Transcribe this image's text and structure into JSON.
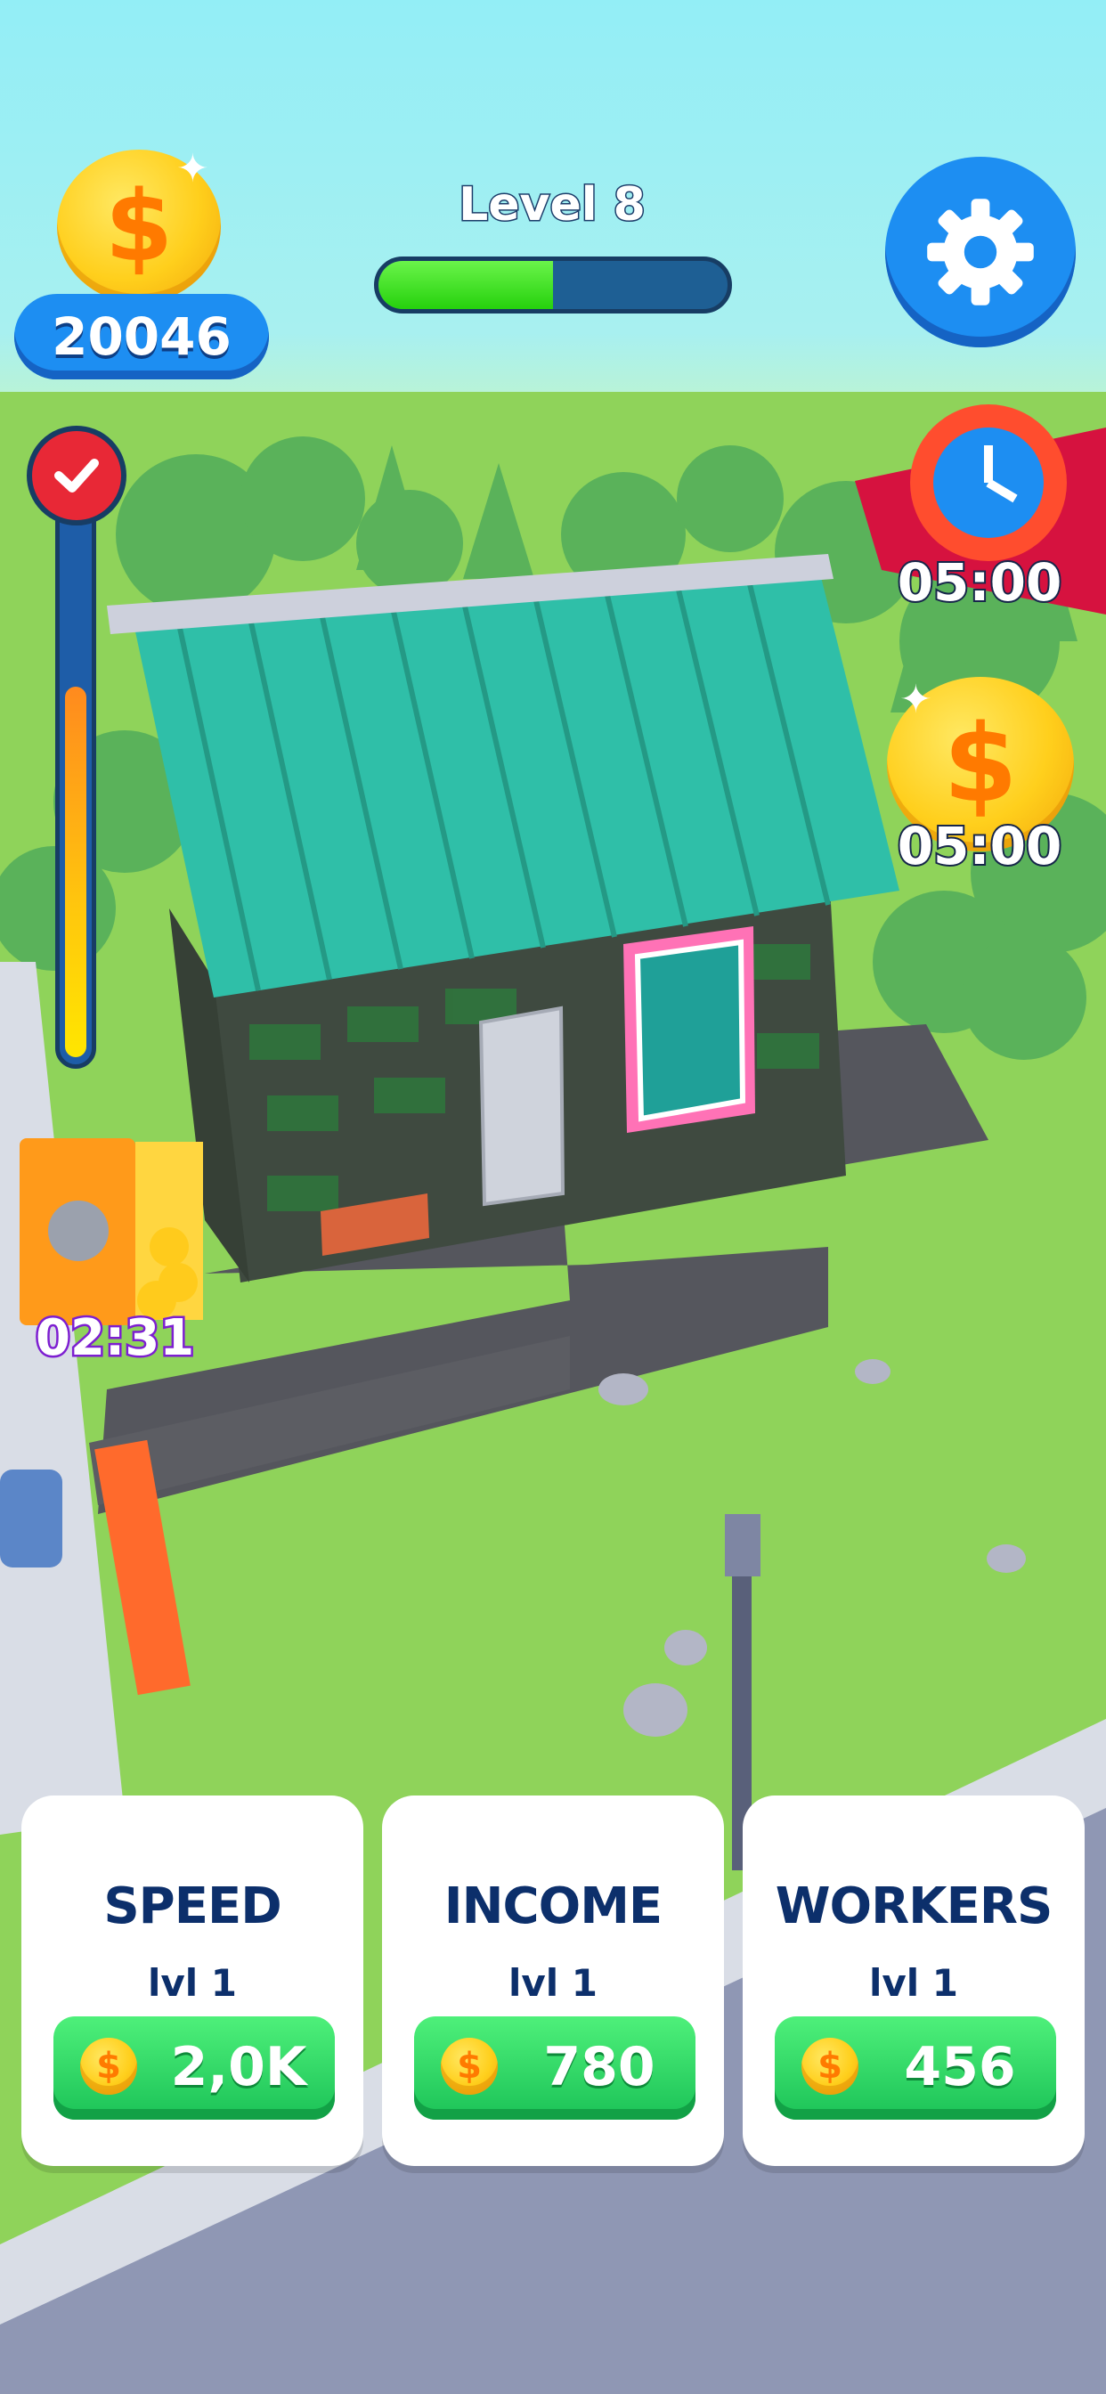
{
  "hud": {
    "coin_icon": "dollar-coin-icon",
    "coin_symbol": "$",
    "coins": "20046",
    "level_label": "Level 8",
    "level_progress": 0.5,
    "settings_icon": "gear-icon"
  },
  "progress_meter": {
    "fill_fraction": 0.66,
    "check_icon": "checkmark-icon"
  },
  "boosts": [
    {
      "icon": "speed-clock-icon",
      "timer": "05:00"
    },
    {
      "icon": "dollar-coin-icon",
      "symbol": "$",
      "timer": "05:00"
    }
  ],
  "safe": {
    "icon": "money-safe-icon",
    "timer": "02:31"
  },
  "upgrades": [
    {
      "title": "SPEED",
      "level": "lvl 1",
      "price": "2,0K",
      "coin_symbol": "$"
    },
    {
      "title": "INCOME",
      "level": "lvl 1",
      "price": "780",
      "coin_symbol": "$"
    },
    {
      "title": "WORKERS",
      "level": "lvl 1",
      "price": "456",
      "coin_symbol": "$"
    }
  ],
  "colors": {
    "sky": "#93eef6",
    "grass": "#8fd35a",
    "hud_blue": "#1d8ef2",
    "button_green": "#1bc257",
    "navy_text": "#0c2f6b",
    "roof_teal": "#2fbfa8"
  }
}
